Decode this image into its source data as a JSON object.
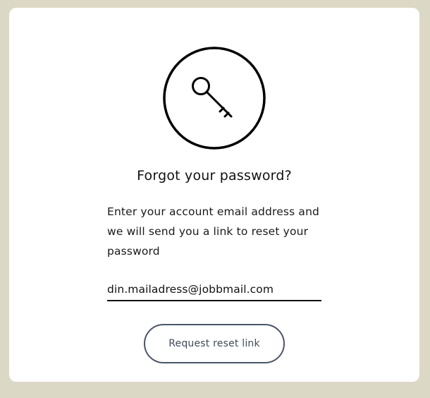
{
  "form": {
    "icon": "key-icon",
    "title": "Forgot your password?",
    "description": "Enter your account email address and we will send you a link to reset your password",
    "email_value": "din.mailadress@jobbmail.com",
    "submit_label": "Request reset link"
  },
  "colors": {
    "page_background": "#dcd8c6",
    "card_background": "#ffffff",
    "text": "#111111",
    "button_border": "#4a5568"
  }
}
